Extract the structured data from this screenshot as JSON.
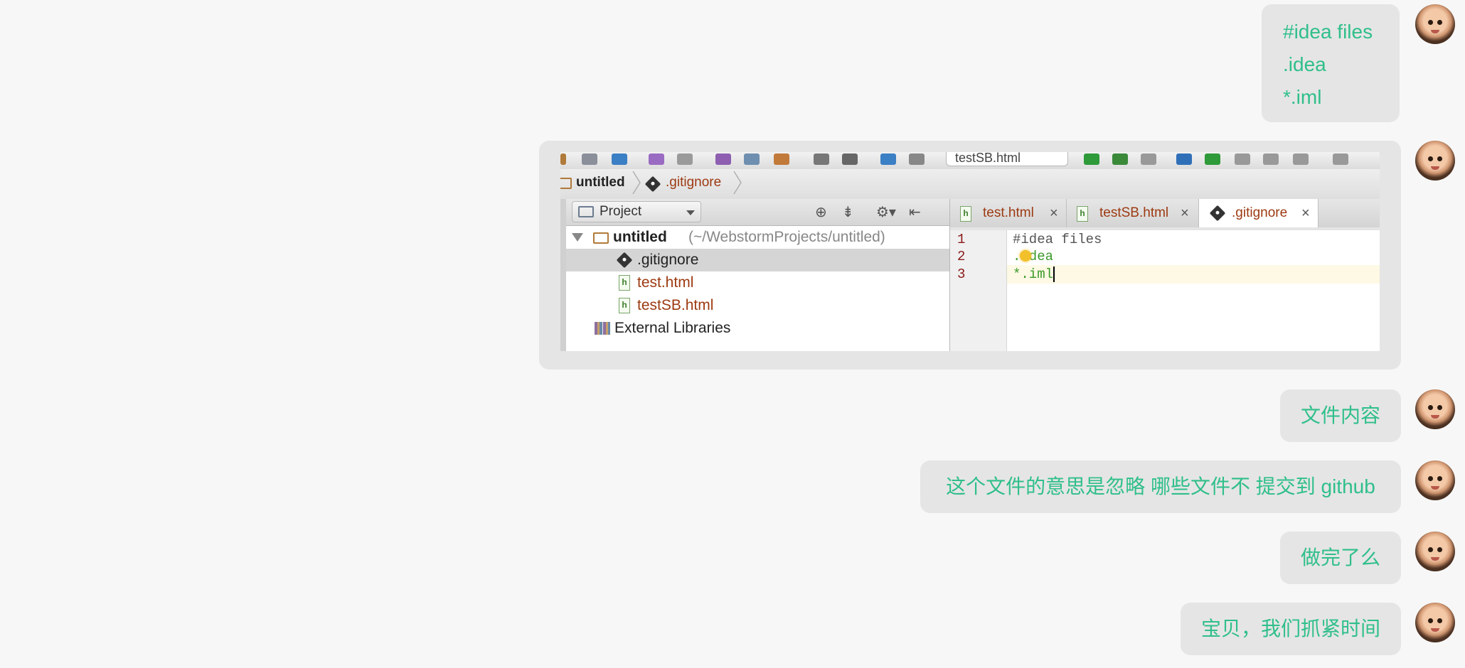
{
  "messages": [
    {
      "type": "text_multiline",
      "lines": [
        "#idea files",
        ".idea",
        "*.iml"
      ]
    },
    {
      "type": "image"
    },
    {
      "type": "text",
      "text": "文件内容"
    },
    {
      "type": "text",
      "text": "这个文件的意思是忽略 哪些文件不 提交到 github"
    },
    {
      "type": "text",
      "text": "做完了么"
    },
    {
      "type": "text",
      "text": "宝贝，我们抓紧时间"
    }
  ],
  "ide": {
    "run_config": "testSB.html",
    "breadcrumb": [
      "untitled",
      ".gitignore"
    ],
    "project_panel": {
      "combo_label": "Project",
      "tree": [
        {
          "label": "untitled",
          "path": "(~/WebstormProjects/untitled)",
          "kind": "folder"
        },
        {
          "label": ".gitignore",
          "kind": "git",
          "selected": true
        },
        {
          "label": "test.html",
          "kind": "html"
        },
        {
          "label": "testSB.html",
          "kind": "html"
        },
        {
          "label": "External Libraries",
          "kind": "library"
        }
      ]
    },
    "tabs": [
      {
        "label": "test.html",
        "close": "×"
      },
      {
        "label": "testSB.html",
        "close": "×"
      },
      {
        "label": ".gitignore",
        "close": "×",
        "active": true
      }
    ],
    "editor": {
      "line_numbers": [
        "1",
        "2",
        "3"
      ],
      "lines": [
        "#idea files",
        ".idea",
        "*.iml"
      ]
    }
  },
  "colors": {
    "message_text": "#2fbf8a",
    "bubble_bg": "#e5e5e5",
    "page_bg": "#f7f7f7",
    "file_modified": "#9c3a11"
  }
}
